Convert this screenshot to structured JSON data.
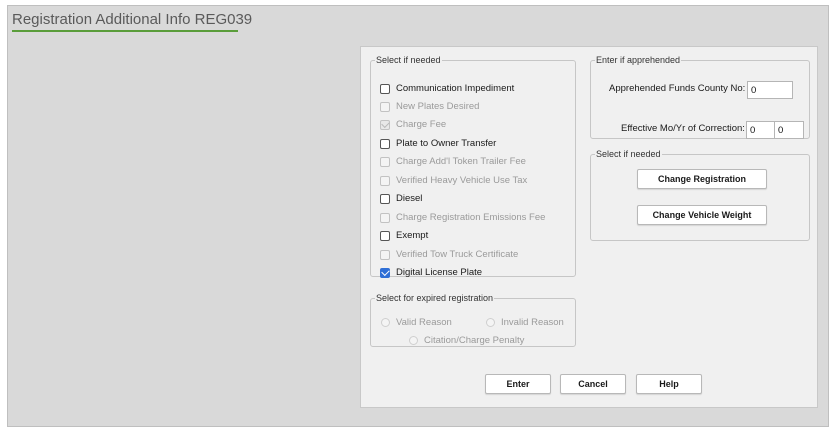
{
  "page": {
    "title": "Registration Additional Info REG039"
  },
  "left_group": {
    "legend": "Select if needed",
    "items": [
      {
        "label": "Communication Impediment",
        "enabled": true,
        "checked": false
      },
      {
        "label": "New Plates Desired",
        "enabled": false,
        "checked": false
      },
      {
        "label": "Charge Fee",
        "enabled": false,
        "checked": true
      },
      {
        "label": "Plate to Owner Transfer",
        "enabled": true,
        "checked": false
      },
      {
        "label": "Charge Add'l Token Trailer Fee",
        "enabled": false,
        "checked": false
      },
      {
        "label": "Verified Heavy Vehicle Use Tax",
        "enabled": false,
        "checked": false
      },
      {
        "label": "Diesel",
        "enabled": true,
        "checked": false
      },
      {
        "label": "Charge Registration Emissions Fee",
        "enabled": false,
        "checked": false
      },
      {
        "label": "Exempt",
        "enabled": true,
        "checked": false
      },
      {
        "label": "Verified Tow Truck Certificate",
        "enabled": false,
        "checked": false
      },
      {
        "label": "Digital License Plate",
        "enabled": true,
        "checked": true
      }
    ]
  },
  "expired_group": {
    "legend": "Select for expired registration",
    "options": [
      "Valid Reason",
      "Invalid Reason",
      "Citation/Charge Penalty"
    ]
  },
  "apprehended_group": {
    "legend": "Enter if apprehended",
    "county_label": "Apprehended Funds County No:",
    "county_value": "0",
    "correction_label": "Effective Mo/Yr of Correction:",
    "correction_month": "0",
    "correction_year": "0"
  },
  "right_select_group": {
    "legend": "Select if needed",
    "change_registration": "Change Registration",
    "change_vehicle_weight": "Change Vehicle Weight"
  },
  "footer": {
    "enter": "Enter",
    "cancel": "Cancel",
    "help": "Help"
  },
  "colors": {
    "accent": "#5a9d3a",
    "checkbox_checked": "#2f6fd6"
  }
}
